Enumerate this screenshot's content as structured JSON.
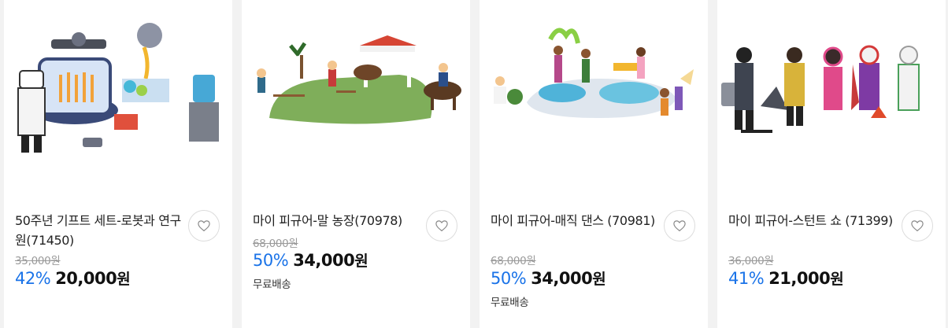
{
  "products": [
    {
      "title": "50주년 기프트 세트-로봇과 연구원(71450)",
      "original_price": "35,000원",
      "discount": "42%",
      "price": "20,000",
      "price_unit": "원",
      "shipping": "",
      "image_icon": "robot-lab-playset-image"
    },
    {
      "title": "마이 피규어-말 농장(70978)",
      "original_price": "68,000원",
      "discount": "50%",
      "price": "34,000",
      "price_unit": "원",
      "shipping": "무료배송",
      "image_icon": "horse-farm-playset-image"
    },
    {
      "title": "마이 피규어-매직 댄스 (70981)",
      "original_price": "68,000원",
      "discount": "50%",
      "price": "34,000",
      "price_unit": "원",
      "shipping": "무료배송",
      "image_icon": "magic-dance-playset-image"
    },
    {
      "title": "마이 피규어-스턴트 쇼 (71399)",
      "original_price": "36,000원",
      "discount": "41%",
      "price": "21,000",
      "price_unit": "원",
      "shipping": "",
      "image_icon": "stunt-show-playset-image"
    }
  ],
  "colors": {
    "discount": "#1a73e8",
    "price": "#111111",
    "original_price": "#9a9a9a",
    "background": "#f2f2f2",
    "card": "#ffffff"
  },
  "icons": {
    "favorite": "heart-icon"
  }
}
